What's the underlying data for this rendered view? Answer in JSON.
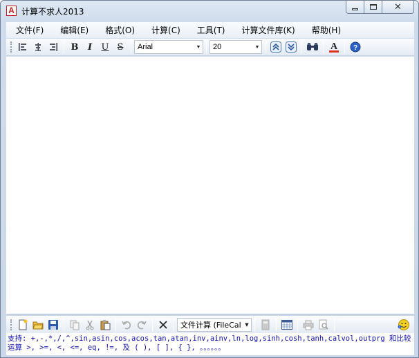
{
  "window": {
    "title": "计算不求人2013"
  },
  "menu": [
    "文件(F)",
    "编辑(E)",
    "格式(O)",
    "计算(C)",
    "工具(T)",
    "计算文件库(K)",
    "帮助(H)"
  ],
  "format_toolbar": {
    "bold": "B",
    "italic": "I",
    "underline": "U",
    "strike": "S",
    "font_family": "Arial",
    "font_size": "20"
  },
  "bottom_toolbar": {
    "mode_select": "文件计算 (FileCal"
  },
  "status": {
    "text": "支持: +,-,*,/,^,sin,asin,cos,acos,tan,atan,inv,ainv,ln,log,sinh,cosh,tanh,calvol,outprg 和比较运算 >, >=, <, <=, eq, !=, 及 ( ), [ ], { }, 。。。。。。"
  },
  "colors": {
    "accent": "#1010b0",
    "font_color_bar": "#e03020",
    "help_blue": "#2a62c8"
  }
}
